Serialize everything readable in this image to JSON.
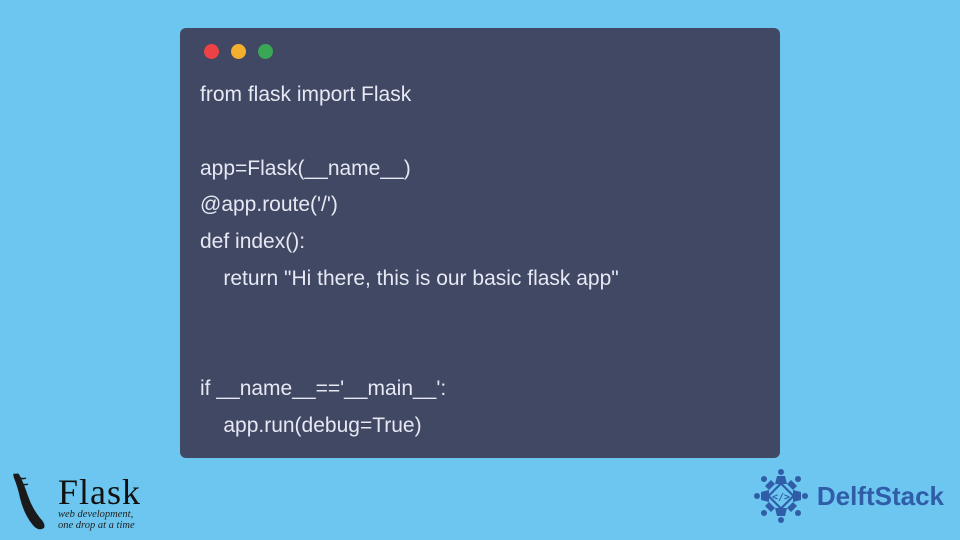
{
  "code": {
    "line1": "from flask import Flask",
    "line2": "",
    "line3": "app=Flask(__name__)",
    "line4": "@app.route('/')",
    "line5": "def index():",
    "line6": "    return \"Hi there, this is our basic flask app\"",
    "line7": "",
    "line8": "",
    "line9": "if __name__=='__main__':",
    "line10": "    app.run(debug=True)"
  },
  "flask": {
    "title": "Flask",
    "subtitle": "web development,\none drop at a time"
  },
  "delft": {
    "title": "DelftStack"
  }
}
